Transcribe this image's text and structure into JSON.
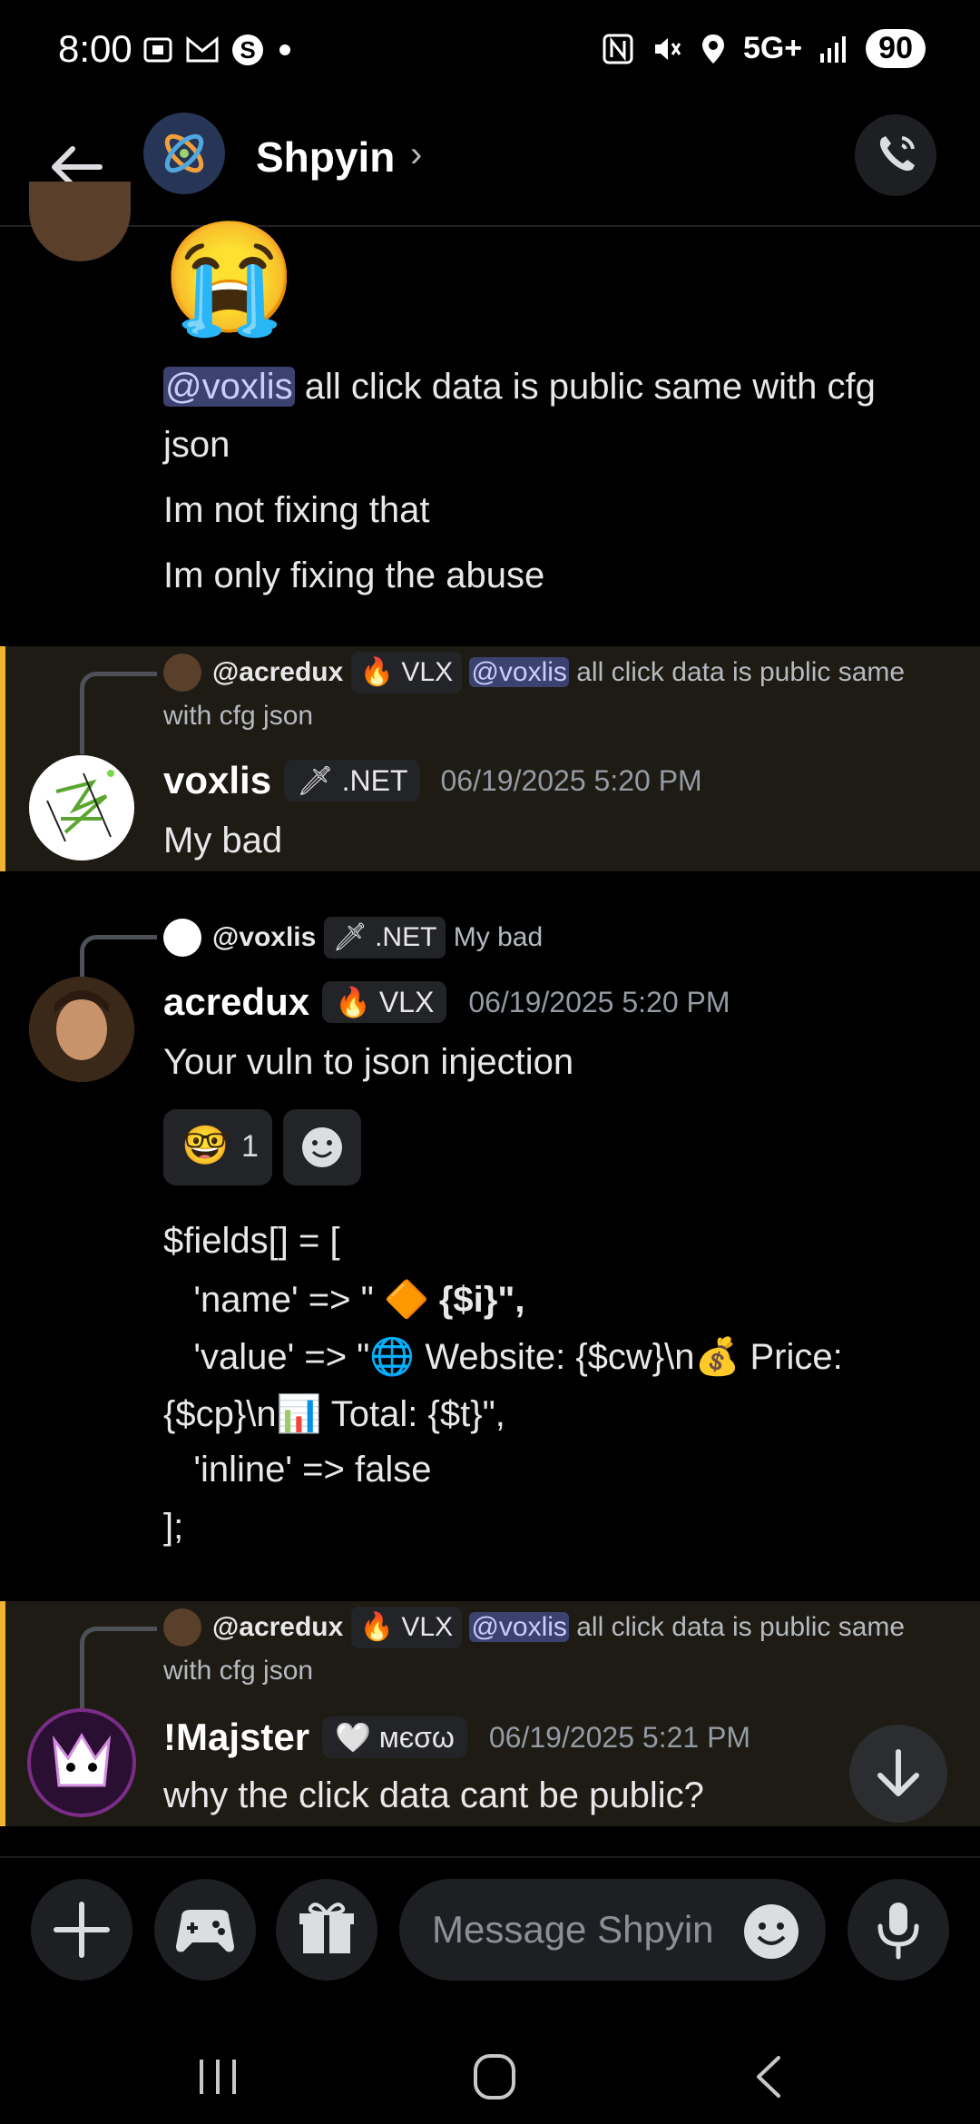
{
  "status": {
    "time": "8:00",
    "network": "5G+",
    "battery": "90",
    "left_icons": [
      "photo-screenshot-icon",
      "gmail-icon",
      "s-app-icon",
      "dot-icon"
    ],
    "right_icons": [
      "nfc-icon",
      "mute-icon",
      "location-icon",
      "signal-icon"
    ]
  },
  "header": {
    "title": "Shpyin",
    "chevron": "›"
  },
  "messages": {
    "m1": {
      "emoji": "😭",
      "mention": "@voxlis",
      "line1_rest": " all click data is public same with cfg",
      "line1_cont": "json",
      "line2": "Im not fixing that",
      "line3": "Im only fixing the abuse"
    },
    "m2": {
      "reply_user": "@acredux",
      "reply_tag": "VLX",
      "reply_mention": "@voxlis",
      "reply_text": " all click data is public same",
      "reply_text_cont": "with cfg json",
      "username": "voxlis",
      "tag": ".NET",
      "timestamp": "06/19/2025 5:20 PM",
      "text": "My bad"
    },
    "m3": {
      "reply_user": "@voxlis",
      "reply_tag": ".NET",
      "reply_text": "My bad",
      "username": "acredux",
      "tag": "VLX",
      "timestamp": "06/19/2025 5:20 PM",
      "text": "Your vuln to json injection",
      "reaction_count": "1"
    },
    "code": {
      "l1": "$fields[] = [",
      "l2a": "   'name' => \" ",
      "l2b": "🔶",
      "l2c": " {$i}\",",
      "l3a": "   'value' => \"",
      "l3b": "🌐",
      "l3c": " Website: {$cw}\\n",
      "l3d": "💰",
      "l3e": " Price:",
      "l4a": "{$cp}\\n",
      "l4b": "📊",
      "l4c": " Total: {$t}\",",
      "l5": "   'inline' => false",
      "l6": "];"
    },
    "m4": {
      "reply_user": "@acredux",
      "reply_tag": "VLX",
      "reply_mention": "@voxlis",
      "reply_text": " all click data is public same",
      "reply_text_cont": "with cfg json",
      "username": "!Majster",
      "tag": "мєσω",
      "timestamp": "06/19/2025 5:21 PM",
      "text": "why the click data cant be public?"
    }
  },
  "composer": {
    "placeholder": "Message Shpyin"
  },
  "colors": {
    "accent": "#f0b232",
    "mention_bg": "#3c4270",
    "panel": "#1e1f22"
  }
}
